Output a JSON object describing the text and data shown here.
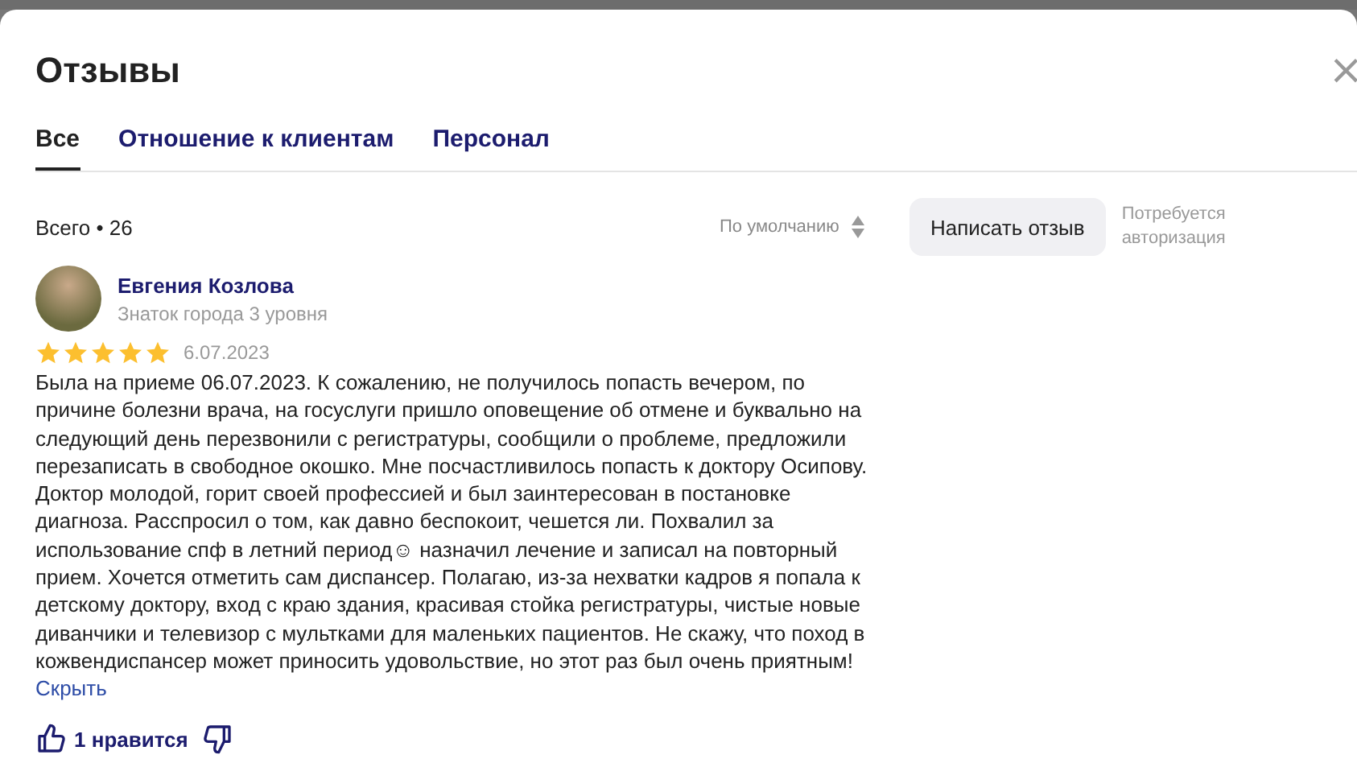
{
  "dialog": {
    "title": "Отзывы",
    "close": "×"
  },
  "tabs": [
    {
      "label": "Все",
      "selected": true
    },
    {
      "label": "Отношение к клиентам",
      "selected": false
    },
    {
      "label": "Персонал",
      "selected": false
    }
  ],
  "summary": {
    "total": "Всего • 26",
    "sort": "По умолчанию",
    "write_button": "Написать отзыв",
    "auth_note": "Потребуется авторизация"
  },
  "reviews": [
    {
      "author": "Евгения Козлова",
      "level": "Знаток города 3 уровня",
      "stars": 5,
      "date": "6.07.2023",
      "text": "Была на приеме 06.07.2023. К сожалению, не получилось попасть вечером, по причине болезни врача, на госуслуги пришло оповещение об отмене и буквально на следующий день перезвонили с регистратуры, сообщили о проблеме, предложили перезаписать в свободное окошко. Мне посчастливилось попасть к доктору Осипову. Доктор молодой, горит своей профессией и был заинтересован в постановке диагноза. Расспросил о том, как давно беспокоит, чешется ли. Похвалил за использование спф в летний период☺ назначил лечение и записал на повторный прием. Хочется отметить сам диспансер. Полагаю, из-за нехватки кадров я попала к детскому доктору, вход с краю здания, красивая стойка регистратуры, чистые новые диванчики и телевизор с мультками для маленьких пациентов. Не скажу, что поход в кожвендиспансер может приносить удовольствие, но этот раз был очень приятным!",
      "collapse": "Скрыть",
      "likes": "1 нравится",
      "liked": false
    }
  ]
}
